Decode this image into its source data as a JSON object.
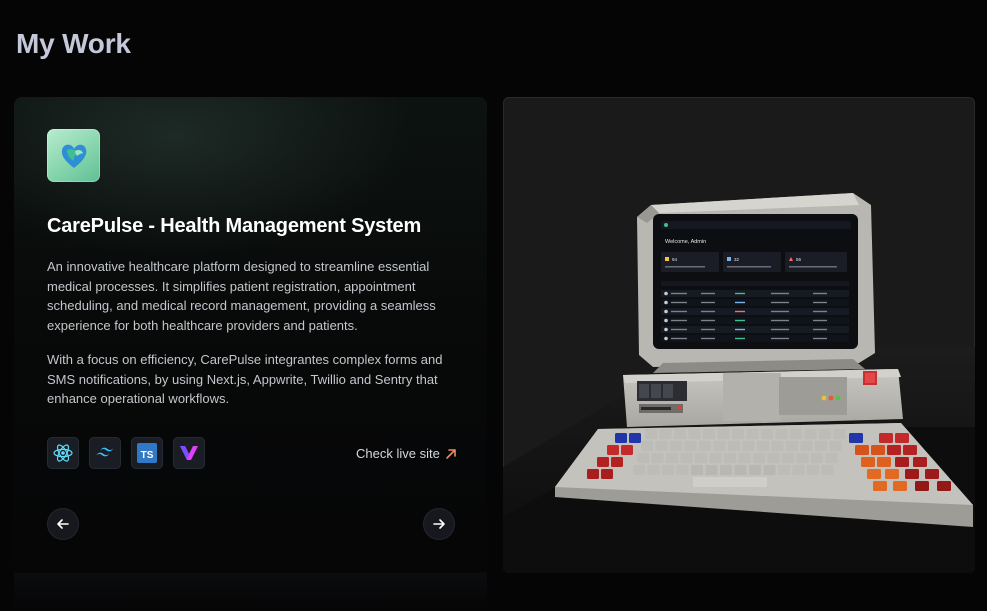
{
  "page": {
    "title": "My Work"
  },
  "project": {
    "logo_icon": "heart-leaf-icon",
    "title": "CarePulse - Health Management System",
    "description_1": "An innovative healthcare platform designed to streamline essential medical processes. It simplifies patient registration, appointment scheduling, and medical record management, providing a seamless experience for both healthcare providers and patients.",
    "description_2": "With a focus on efficiency, CarePulse integrantes complex forms and SMS notifications, by using Next.js, Appwrite, Twillio and Sentry that enhance operational workflows.",
    "tech_stack": [
      {
        "name": "react-icon",
        "color": "#61dafb"
      },
      {
        "name": "tailwind-icon",
        "color": "#38bdf8"
      },
      {
        "name": "typescript-icon",
        "color": "#3178c6"
      },
      {
        "name": "appwrite-icon",
        "color": "#e040fb"
      }
    ],
    "live_link_label": "Check live site",
    "accent_color": "#f08a5d"
  },
  "navigation": {
    "prev_icon": "arrow-left-icon",
    "next_icon": "arrow-right-icon"
  },
  "preview": {
    "screen": {
      "welcome": "Welcome, Admin",
      "stats": [
        "94",
        "32",
        "56"
      ]
    }
  }
}
